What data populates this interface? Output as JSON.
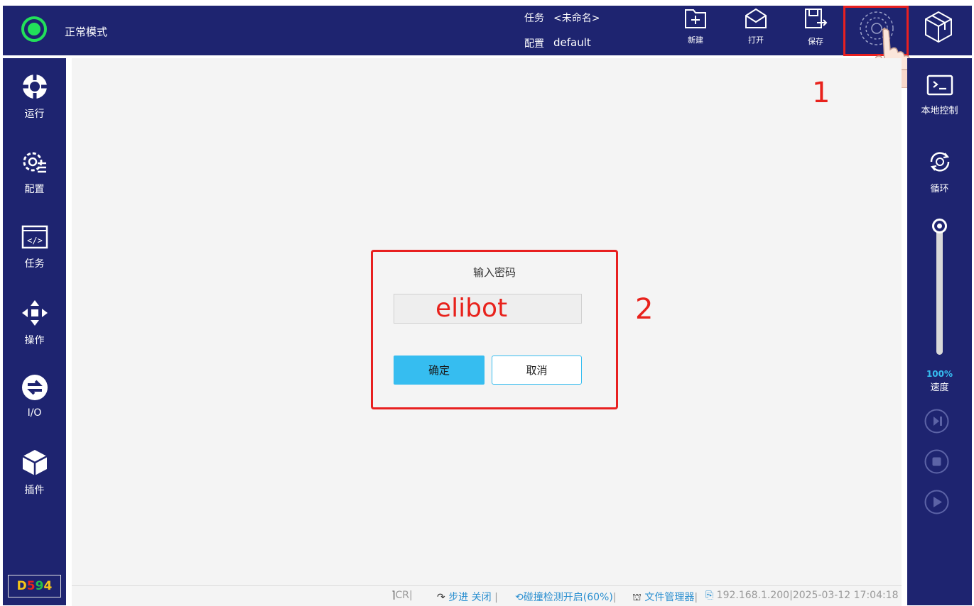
{
  "header": {
    "mode_label": "正常模式",
    "task_key": "任务",
    "task_value": "<未命名>",
    "config_key": "配置",
    "config_value": "default",
    "buttons": [
      {
        "id": "new",
        "label": "新建",
        "icon": "new-file-icon"
      },
      {
        "id": "open",
        "label": "打开",
        "icon": "open-envelope-icon"
      },
      {
        "id": "save",
        "label": "保存",
        "icon": "save-icon"
      }
    ]
  },
  "sidebar": {
    "items": [
      {
        "label": "运行",
        "icon": "run-icon"
      },
      {
        "label": "配置",
        "icon": "config-gear-icon"
      },
      {
        "label": "任务",
        "icon": "task-code-icon"
      },
      {
        "label": "操作",
        "icon": "move-arrows-icon"
      },
      {
        "label": "I/O",
        "icon": "io-arrows-icon"
      },
      {
        "label": "插件",
        "icon": "plugin-box-icon"
      }
    ],
    "badge": {
      "part1": "D",
      "part2": "5",
      "part3": "9",
      "part4": "4"
    }
  },
  "right_panel": {
    "local_control_label": "本地控制",
    "loop_label": "循环",
    "speed_value": "100%",
    "speed_label": "速度"
  },
  "dialog": {
    "title": "输入密码",
    "password_text": "elibot",
    "confirm_label": "确定",
    "cancel_label": "取消"
  },
  "annotations": {
    "step1": "1",
    "step2": "2"
  },
  "statusbar": {
    "cr": "CR",
    "step_label": "步进",
    "step_state": "关闭",
    "collision": "碰撞检测开启(60%)",
    "file_manager": "文件管理器",
    "ip": "192.168.1.200",
    "datetime": "2025-03-12 17:04:18"
  },
  "colors": {
    "bar": "#1e2470",
    "accent": "#36bdf0",
    "status_green": "#22e05a",
    "annotation_red": "#e8221c"
  }
}
